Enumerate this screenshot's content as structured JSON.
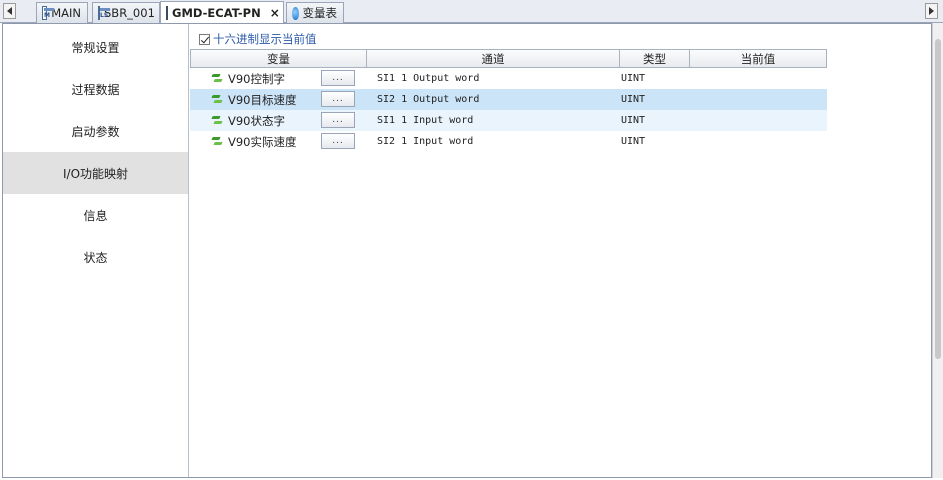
{
  "tabs": [
    {
      "label": "MAIN",
      "icon": "main-program-icon",
      "active": false
    },
    {
      "label": "SBR_001",
      "icon": "subroutine-icon",
      "active": false
    },
    {
      "label": "GMD-ECAT-PN",
      "icon": "device-config-icon",
      "active": true,
      "close": "×"
    },
    {
      "label": "变量表",
      "icon": "variable-table-icon",
      "active": false
    }
  ],
  "sidebar": {
    "items": [
      {
        "label": "常规设置"
      },
      {
        "label": "过程数据"
      },
      {
        "label": "启动参数"
      },
      {
        "label": "I/O功能映射",
        "active": true
      },
      {
        "label": "信息"
      },
      {
        "label": "状态"
      }
    ]
  },
  "hex_option": {
    "label": "十六进制显示当前值",
    "checked": true
  },
  "table": {
    "columns": [
      "变量",
      "通道",
      "类型",
      "当前值"
    ],
    "rows": [
      {
        "variable": "V90控制字",
        "button": "...",
        "channel": "SI1 1 Output word",
        "type": "UINT",
        "value": ""
      },
      {
        "variable": "V90目标速度",
        "button": "...",
        "channel": "SI2 1 Output word",
        "type": "UINT",
        "value": ""
      },
      {
        "variable": "V90状态字",
        "button": "...",
        "channel": "SI1 1 Input word",
        "type": "UINT",
        "value": ""
      },
      {
        "variable": "V90实际速度",
        "button": "...",
        "channel": "SI2 1 Input word",
        "type": "UINT",
        "value": ""
      }
    ]
  },
  "colors": {
    "selected_row": "#cce4f7",
    "hover_row": "#e9f4fc",
    "active_side_item": "#e1e1e1",
    "hex_label": "#2b5aa8"
  }
}
